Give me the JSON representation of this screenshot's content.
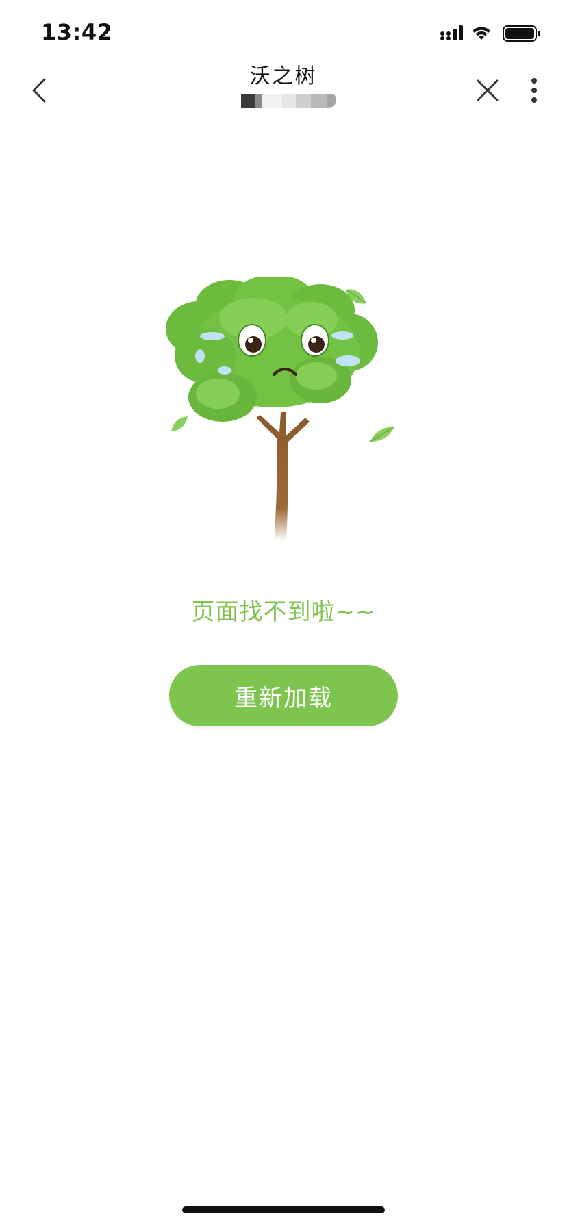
{
  "status_bar": {
    "time": "13:42",
    "icons": [
      "cellular-signal-icon",
      "wifi-icon",
      "battery-icon"
    ]
  },
  "nav": {
    "title": "沃之树",
    "icons": [
      "back-chevron-icon",
      "close-icon",
      "more-vertical-icon"
    ]
  },
  "main": {
    "illustration": "sad-tree-illustration",
    "message": "页面找不到啦~~",
    "reload_label": "重新加载"
  },
  "colors": {
    "accent_green": "#7dc54f",
    "message_green": "#7fc24f",
    "background": "#ffffff"
  }
}
